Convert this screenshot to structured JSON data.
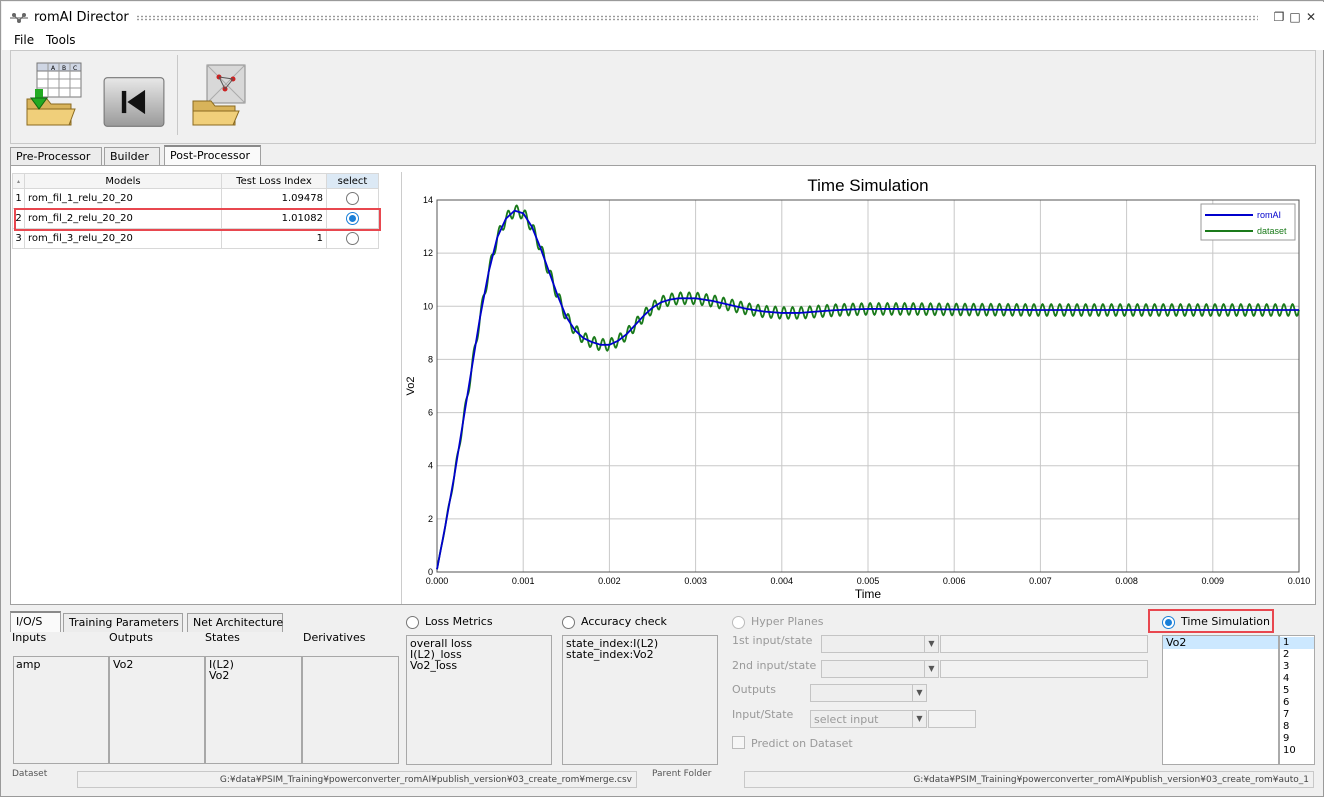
{
  "app": {
    "title": "romAI Director",
    "menu": [
      "File",
      "Tools"
    ]
  },
  "toolbar": {
    "icons": [
      "import-dataset-icon",
      "rewind-icon",
      "open-model-icon"
    ]
  },
  "top_tabs": [
    {
      "label": "Pre-Processor"
    },
    {
      "label": "Builder"
    },
    {
      "label": "Post-Processor",
      "active": true
    }
  ],
  "models_table": {
    "headers": [
      "Models",
      "Test Loss Index",
      "select"
    ],
    "rows": [
      {
        "index": "1",
        "model": "rom_fil_1_relu_20_20",
        "loss": "1.09478",
        "selected": false
      },
      {
        "index": "2",
        "model": "rom_fil_2_relu_20_20",
        "loss": "1.01082",
        "selected": true
      },
      {
        "index": "3",
        "model": "rom_fil_3_relu_20_20",
        "loss": "1",
        "selected": false
      }
    ]
  },
  "chart_data": {
    "type": "line",
    "title": "Time Simulation",
    "xlabel": "Time",
    "ylabel": "Vo2",
    "xlim": [
      0,
      0.01
    ],
    "ylim": [
      0,
      14
    ],
    "xticks": [
      "0.000",
      "0.001",
      "0.002",
      "0.003",
      "0.004",
      "0.005",
      "0.006",
      "0.007",
      "0.008",
      "0.009",
      "0.010"
    ],
    "yticks": [
      "0",
      "2",
      "4",
      "6",
      "8",
      "10",
      "12",
      "14"
    ],
    "grid": true,
    "legend_position": "top-right",
    "series": [
      {
        "name": "romAI",
        "color": "#0000cc",
        "x": [
          0,
          0.0001,
          0.0002,
          0.0003,
          0.0004,
          0.0005,
          0.0006,
          0.0007,
          0.0008,
          0.0009,
          0.001,
          0.0011,
          0.0012,
          0.0013,
          0.0014,
          0.0015,
          0.0016,
          0.0017,
          0.0018,
          0.0019,
          0.002,
          0.0021,
          0.0022,
          0.0023,
          0.0024,
          0.0025,
          0.0026,
          0.0027,
          0.0028,
          0.0029,
          0.003,
          0.0032,
          0.0034,
          0.0036,
          0.0038,
          0.004,
          0.0042,
          0.0044,
          0.0046,
          0.0048,
          0.005,
          0.0055,
          0.006,
          0.0065,
          0.007,
          0.0075,
          0.008,
          0.0085,
          0.009,
          0.0095,
          0.01
        ],
        "y": [
          0.1,
          1.8,
          3.6,
          5.6,
          7.6,
          9.6,
          11.3,
          12.6,
          13.3,
          13.6,
          13.5,
          13.0,
          12.2,
          11.3,
          10.4,
          9.6,
          9.1,
          8.8,
          8.65,
          8.55,
          8.55,
          8.7,
          8.95,
          9.3,
          9.65,
          9.95,
          10.15,
          10.25,
          10.3,
          10.3,
          10.3,
          10.2,
          10.05,
          9.9,
          9.8,
          9.75,
          9.75,
          9.8,
          9.85,
          9.88,
          9.9,
          9.9,
          9.88,
          9.87,
          9.86,
          9.86,
          9.86,
          9.86,
          9.86,
          9.86,
          9.86
        ]
      },
      {
        "name": "dataset",
        "color": "#1a7a1a",
        "ripple_amplitude": 0.22,
        "ripple_period": 0.0001
      }
    ]
  },
  "bottom_tabs": [
    {
      "label": "I/O/S",
      "active": true
    },
    {
      "label": "Training Parameters"
    },
    {
      "label": "Net Architecture"
    }
  ],
  "ios": {
    "headers": [
      "Inputs",
      "Outputs",
      "States",
      "Derivatives"
    ],
    "inputs": [
      "amp"
    ],
    "outputs": [
      "Vo2"
    ],
    "states": [
      "I(L2)",
      "Vo2"
    ],
    "derivatives": []
  },
  "loss_metrics": {
    "label": "Loss Metrics",
    "items": [
      "overall loss",
      "I(L2)_loss",
      "Vo2_loss"
    ]
  },
  "accuracy_check": {
    "label": "Accuracy check",
    "items": [
      "state_index:I(L2)",
      "state_index:Vo2"
    ]
  },
  "hyper_planes": {
    "label": "Hyper Planes",
    "first": "1st input/state",
    "second": "2nd input/state",
    "outputs": "Outputs",
    "input_state": "Input/State",
    "select_input": "select input",
    "predict": "Predict on Dataset"
  },
  "time_simulation": {
    "label": "Time Simulation",
    "list": [
      "Vo2"
    ],
    "numbers": [
      "1",
      "2",
      "3",
      "4",
      "5",
      "6",
      "7",
      "8",
      "9",
      "10"
    ]
  },
  "footer": {
    "dataset_label": "Dataset",
    "dataset_path": "G:¥data¥PSIM_Training¥powerconverter_romAI¥publish_version¥03_create_rom¥merge.csv",
    "parent_label": "Parent Folder",
    "parent_path": "G:¥data¥PSIM_Training¥powerconverter_romAI¥publish_version¥03_create_rom¥auto_1"
  }
}
